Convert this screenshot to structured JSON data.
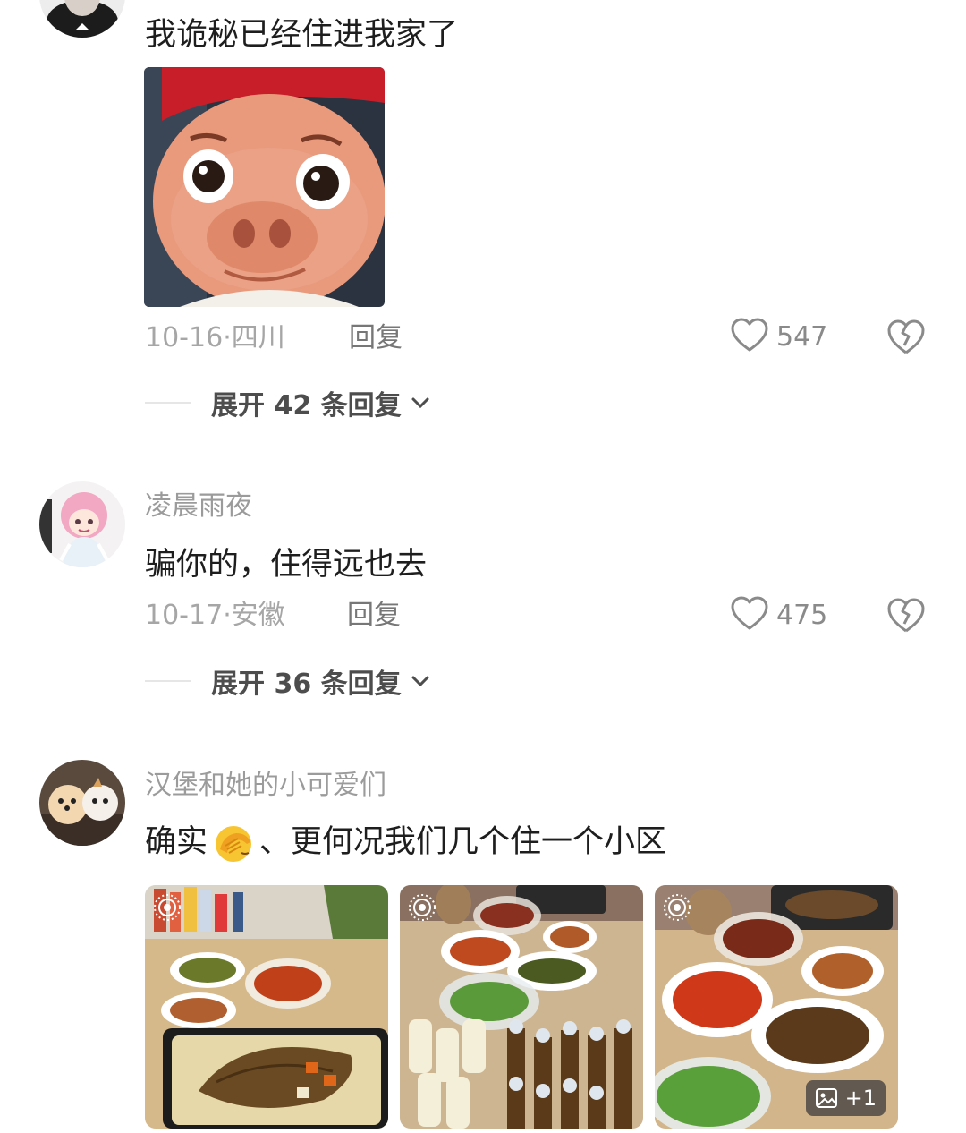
{
  "comments": [
    {
      "text": "我诡秘已经住进我家了",
      "sticker_icon": "cartoon-pig-sticker",
      "date": "10-16",
      "location": "四川",
      "reply_label": "回复",
      "likes": "547",
      "expand_label": "展开 42 条回复"
    },
    {
      "username": "凌晨雨夜",
      "text": "骗你的，住得远也去",
      "date": "10-17",
      "location": "安徽",
      "reply_label": "回复",
      "likes": "475",
      "expand_label": "展开 36 条回复"
    },
    {
      "username": "汉堡和她的小可爱们",
      "text_before": "确实",
      "emoji": "facepalm-emoji",
      "text_after": "、更何况我们几个住一个小区",
      "photos": [
        "food-photo-fish-table",
        "food-photo-drinks-table",
        "food-photo-dishes-table"
      ],
      "more_photos_label": "+1"
    }
  ],
  "separator": "·",
  "colors": {
    "meta_gray": "#a6a6a6",
    "text_dark": "#1e1e1e",
    "expand_gray": "#4d4d4d"
  }
}
